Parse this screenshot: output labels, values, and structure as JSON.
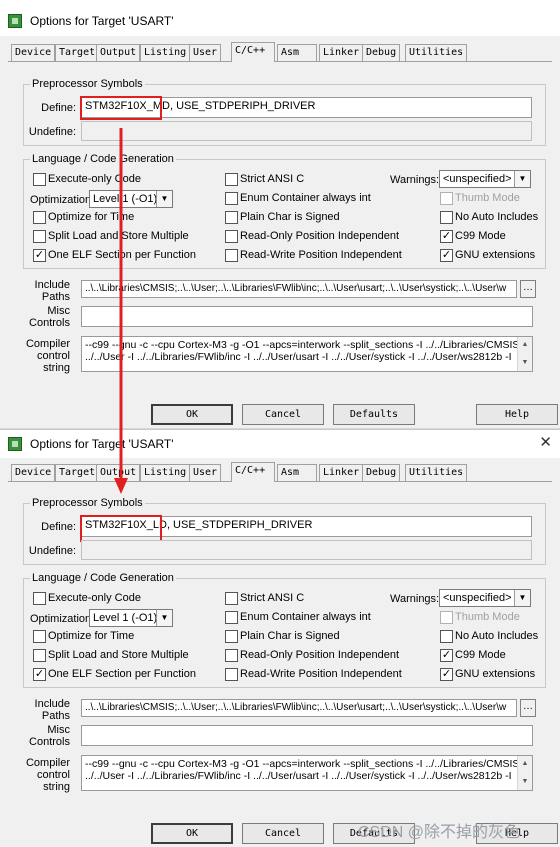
{
  "annotation": {
    "arrow_color": "#e02020",
    "box_color": "#e02020"
  },
  "watermark": "CSDN @除不掉的灰色",
  "dialogs": [
    {
      "title": "Options for Target 'USART'",
      "tabs": [
        "Device",
        "Target",
        "Output",
        "Listing",
        "User",
        "C/C++",
        "Asm",
        "Linker",
        "Debug",
        "Utilities"
      ],
      "active_tab": "C/C++",
      "preprocessor": {
        "group_title": "Preprocessor Symbols",
        "define_label": "Define:",
        "define_highlight": "STM32F10X_MD",
        "define_rest": ", USE_STDPERIPH_DRIVER",
        "undefine_label": "Undefine:",
        "undefine_value": ""
      },
      "codegen": {
        "group_title": "Language / Code Generation",
        "execute_only": "Execute-only Code",
        "optimization_label": "Optimization:",
        "optimization_value": "Level 1 (-O1)",
        "optimize_time": "Optimize for Time",
        "split_load": "Split Load and Store Multiple",
        "one_elf": "One ELF Section per Function",
        "strict_ansi": "Strict ANSI C",
        "enum_container": "Enum Container always int",
        "plain_char": "Plain Char is Signed",
        "ro_pi": "Read-Only Position Independent",
        "rw_pi": "Read-Write Position Independent",
        "warnings_label": "Warnings:",
        "warnings_value": "<unspecified>",
        "thumb_mode": "Thumb Mode",
        "no_auto_includes": "No Auto Includes",
        "c99_mode": "C99 Mode",
        "gnu_ext": "GNU extensions"
      },
      "include_label_1": "Include",
      "include_label_2": "Paths",
      "include_value": "..\\..\\Libraries\\CMSIS;..\\..\\User;..\\..\\Libraries\\FWlib\\inc;..\\..\\User\\usart;..\\..\\User\\systick;..\\..\\User\\w",
      "misc_label_1": "Misc",
      "misc_label_2": "Controls",
      "misc_value": "",
      "compiler_label_1": "Compiler",
      "compiler_label_2": "control",
      "compiler_label_3": "string",
      "compiler_line_1": "--c99 --gnu -c --cpu Cortex-M3 -g -O1 --apcs=interwork --split_sections -I ../../Libraries/CMSIS -I",
      "compiler_line_2": "../../User -I ../../Libraries/FWlib/inc -I ../../User/usart -I ../../User/systick -I ../../User/ws2812b -I",
      "buttons": {
        "ok": "OK",
        "cancel": "Cancel",
        "defaults": "Defaults",
        "help": "Help"
      }
    },
    {
      "title": "Options for Target 'USART'",
      "tabs": [
        "Device",
        "Target",
        "Output",
        "Listing",
        "User",
        "C/C++",
        "Asm",
        "Linker",
        "Debug",
        "Utilities"
      ],
      "active_tab": "C/C++",
      "preprocessor": {
        "group_title": "Preprocessor Symbols",
        "define_label": "Define:",
        "define_highlight": "STM32F10X_LD",
        "define_rest": ", USE_STDPERIPH_DRIVER",
        "undefine_label": "Undefine:",
        "undefine_value": ""
      },
      "codegen": {
        "group_title": "Language / Code Generation",
        "execute_only": "Execute-only Code",
        "optimization_label": "Optimization:",
        "optimization_value": "Level 1 (-O1)",
        "optimize_time": "Optimize for Time",
        "split_load": "Split Load and Store Multiple",
        "one_elf": "One ELF Section per Function",
        "strict_ansi": "Strict ANSI C",
        "enum_container": "Enum Container always int",
        "plain_char": "Plain Char is Signed",
        "ro_pi": "Read-Only Position Independent",
        "rw_pi": "Read-Write Position Independent",
        "warnings_label": "Warnings:",
        "warnings_value": "<unspecified>",
        "thumb_mode": "Thumb Mode",
        "no_auto_includes": "No Auto Includes",
        "c99_mode": "C99 Mode",
        "gnu_ext": "GNU extensions"
      },
      "include_label_1": "Include",
      "include_label_2": "Paths",
      "include_value": "..\\..\\Libraries\\CMSIS;..\\..\\User;..\\..\\Libraries\\FWlib\\inc;..\\..\\User\\usart;..\\..\\User\\systick;..\\..\\User\\w",
      "misc_label_1": "Misc",
      "misc_label_2": "Controls",
      "misc_value": "",
      "compiler_label_1": "Compiler",
      "compiler_label_2": "control",
      "compiler_label_3": "string",
      "compiler_line_1": "--c99 --gnu -c --cpu Cortex-M3 -g -O1 --apcs=interwork --split_sections -I ../../Libraries/CMSIS -I",
      "compiler_line_2": "../../User -I ../../Libraries/FWlib/inc -I ../../User/usart -I ../../User/systick -I ../../User/ws2812b -I",
      "buttons": {
        "ok": "OK",
        "cancel": "Cancel",
        "defaults": "Defaults",
        "help": "Help"
      }
    }
  ]
}
